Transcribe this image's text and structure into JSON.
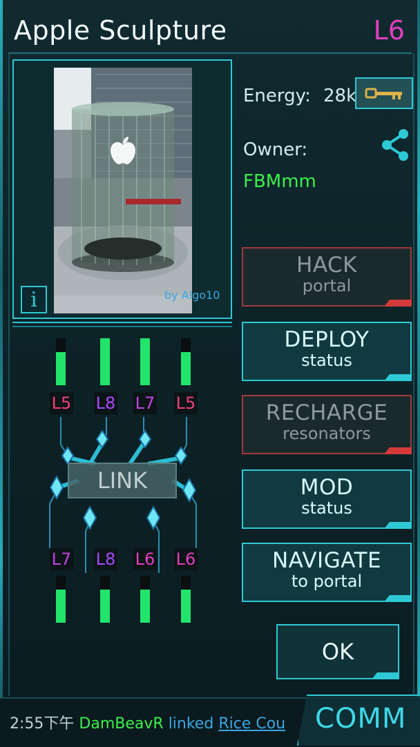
{
  "portal": {
    "title": "Apple Sculpture",
    "level": "L6",
    "photo_credit": "by Algo10",
    "info_label": "i"
  },
  "stats": {
    "energy_label": "Energy:",
    "energy_value": "28k",
    "owner_label": "Owner:",
    "owner_name": "FBMmm"
  },
  "actions": {
    "hack_main": "HACK",
    "hack_sub": "portal",
    "deploy_main": "DEPLOY",
    "deploy_sub": "status",
    "recharge_main": "RECHARGE",
    "recharge_sub": "resonators",
    "mod_main": "MOD",
    "mod_sub": "status",
    "navigate_main": "NAVIGATE",
    "navigate_sub": "to portal",
    "ok": "OK",
    "link": "LINK"
  },
  "resonators": {
    "top": [
      {
        "label": "L5",
        "color": "#f0407a",
        "fill": 0.7
      },
      {
        "label": "L8",
        "color": "#a64bff",
        "fill": 1.0
      },
      {
        "label": "L7",
        "color": "#c044e0",
        "fill": 1.0
      },
      {
        "label": "L5",
        "color": "#f0407a",
        "fill": 0.7
      }
    ],
    "bottom": [
      {
        "label": "L7",
        "color": "#c044e0",
        "fill": 0.7
      },
      {
        "label": "L8",
        "color": "#a64bff",
        "fill": 0.7
      },
      {
        "label": "L6",
        "color": "#e23fc0",
        "fill": 0.7
      },
      {
        "label": "L6",
        "color": "#e23fc0",
        "fill": 0.7
      }
    ]
  },
  "comm": {
    "time": "2:55下午",
    "agent": "DamBeavR",
    "verb": "linked",
    "portal": "Rice Cou",
    "tab_label": "COMM"
  },
  "colors": {
    "accent": "#2fc9d6",
    "resistance_green": "#3cf04c",
    "resonator_fill": "#21e56b",
    "disabled_border": "#a13a3a",
    "level_magenta": "#e23fc0"
  },
  "icons": {
    "share": "share-icon",
    "key": "key-icon",
    "info": "info-icon"
  }
}
